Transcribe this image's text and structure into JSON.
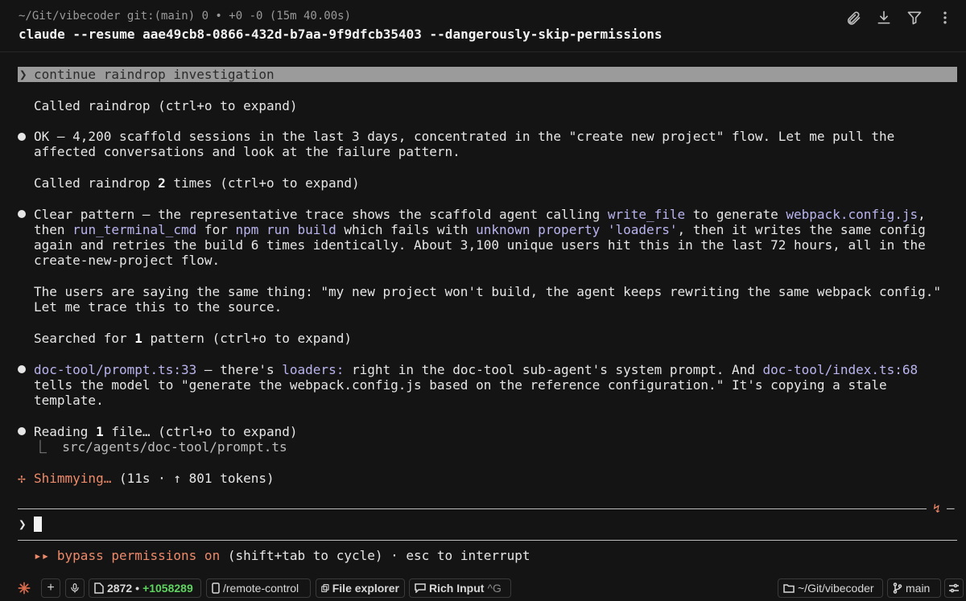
{
  "header": {
    "path_line": "~/Git/vibecoder git:(main) 0 • +0 -0 (15m 40.00s)",
    "command": "claude --resume aae49cb8-0866-432d-b7aa-9f9dfcb35403 --dangerously-skip-permissions",
    "icons": [
      "paperclip-icon",
      "download-icon",
      "filter-icon",
      "more-vertical-icon"
    ]
  },
  "transcript": {
    "prompt": {
      "chevron": "❯",
      "text": "continue raindrop investigation"
    },
    "called1": "Called raindrop (ctrl+o to expand)",
    "msg1": {
      "l1": "OK — 4,200 scaffold sessions in the last 3 days, concentrated in the \"create new project\" flow. Let me pull the",
      "l2": "affected conversations and look at the failure pattern."
    },
    "called2": {
      "a": "Called raindrop ",
      "b": "2",
      "c": " times (ctrl+o to expand)"
    },
    "msg2": {
      "l1a": "Clear pattern — the representative trace shows the scaffold agent calling ",
      "l1b": "write_file",
      "l1c": " to generate ",
      "l1d": "webpack.config.js",
      "l1e": ",",
      "l2a": "then ",
      "l2b": "run_terminal_cmd",
      "l2c": " for ",
      "l2d": "npm run build",
      "l2e": " which fails with ",
      "l2f": "unknown property 'loaders'",
      "l2g": ", then it writes the same config",
      "l3": "again and retries the build 6 times identically. About 3,100 unique users hit this in the last 72 hours, all in the",
      "l4": "create-new-project flow."
    },
    "msg3": {
      "l1": "The users are saying the same thing: \"my new project won't build, the agent keeps rewriting the same webpack config.\"",
      "l2": "Let me trace this to the source."
    },
    "searched": {
      "a": "Searched for ",
      "b": "1",
      "c": " pattern (ctrl+o to expand)"
    },
    "msg4": {
      "l1a": "doc-tool/prompt.ts:33",
      "l1b": " — there's ",
      "l1c": "loaders:",
      "l1d": " right in the doc-tool sub-agent's system prompt. And ",
      "l1e": "doc-tool/index.ts:68",
      "l2": "tells the model to \"generate the webpack.config.js based on the reference configuration.\" It's copying a stale",
      "l3": "template."
    },
    "reading": {
      "a": "Reading ",
      "b": "1",
      "c": " file… (ctrl+o to expand)",
      "sub": "⎿  src/agents/doc-tool/prompt.ts"
    },
    "spinner": {
      "glyph": "✢",
      "word": "Shimmying…",
      "rest": " (11s · ↑ 801 tokens)"
    }
  },
  "input": {
    "chevron": "❯",
    "rule_glyph": "↯",
    "rule_dash": "—"
  },
  "mode_line": {
    "arrows": "▸▸",
    "text": "bypass permissions on",
    "rest": " (shift+tab to cycle) · esc to interrupt"
  },
  "status_bar": {
    "logo_icon": "claude-spark-icon",
    "plus": "+",
    "mic_icon": "mic-icon",
    "lines": "2872",
    "sep": "•",
    "added": "+1058289",
    "remote": "/remote-control",
    "explorer": "File explorer",
    "rich": "Rich Input",
    "rich_shortcut": "^G",
    "folder": "~/Git/vibecoder",
    "branch": "main"
  },
  "colors": {
    "accent": "#b9b4ee",
    "orange": "#ee8a6a",
    "green": "#5fd35f",
    "background": "#141414"
  }
}
